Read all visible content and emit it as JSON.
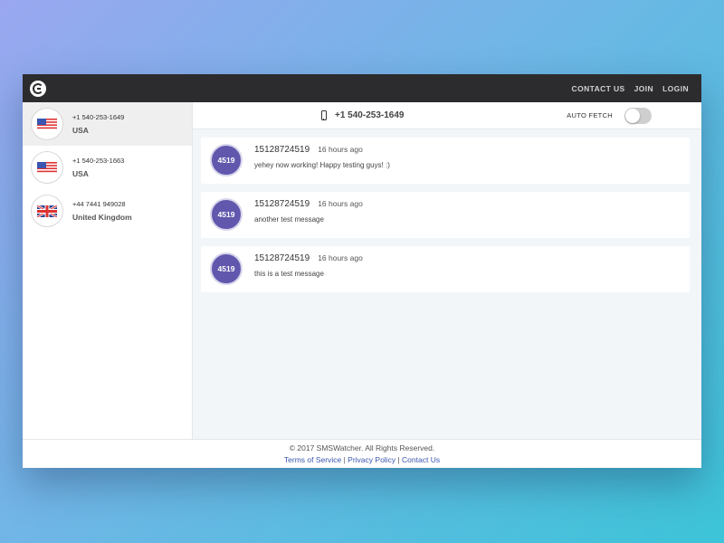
{
  "nav": {
    "contact_us": "CONTACT US",
    "join": "JOIN",
    "login": "LOGIN"
  },
  "sidebar": {
    "contacts": [
      {
        "number": "+1 540-253-1649",
        "country": "USA",
        "flag": "us-flag-icon"
      },
      {
        "number": "+1 540-253-1663",
        "country": "USA",
        "flag": "us-flag-icon"
      },
      {
        "number": "+44 7441 949028",
        "country": "United Kingdom",
        "flag": "uk-flag-icon"
      }
    ]
  },
  "header": {
    "number": "+1 540-253-1649",
    "auto_fetch_label": "AUTO FETCH",
    "auto_fetch_on": false
  },
  "messages": [
    {
      "avatar": "4519",
      "sender": "15128724519",
      "time": "16 hours ago",
      "text": "yehey now working! Happy testing guys! :)"
    },
    {
      "avatar": "4519",
      "sender": "15128724519",
      "time": "16 hours ago",
      "text": "another test message"
    },
    {
      "avatar": "4519",
      "sender": "15128724519",
      "time": "16 hours ago",
      "text": "this is a test message"
    }
  ],
  "footer": {
    "copyright": "© 2017 SMSWatcher. All Rights Reserved.",
    "terms": "Terms of Service",
    "privacy": "Privacy Policy",
    "contact": "Contact Us",
    "separator": "|"
  },
  "colors": {
    "topbar": "#2c2c2e",
    "avatar": "#6157ad",
    "link": "#3a56b0",
    "active_row": "#efefef"
  }
}
